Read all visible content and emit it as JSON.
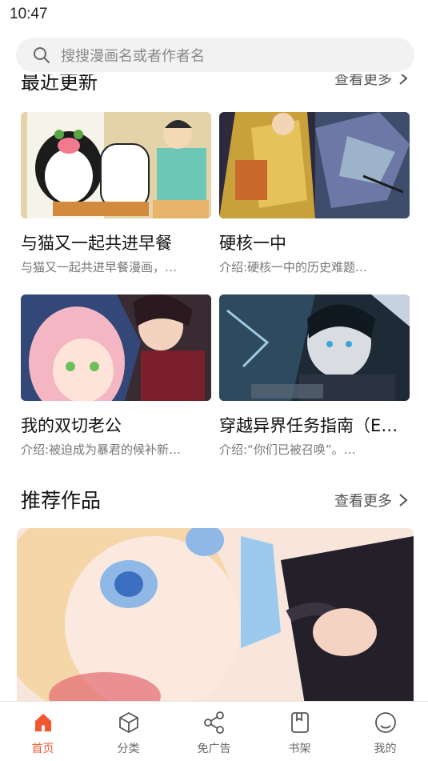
{
  "status": {
    "time": "10:47"
  },
  "search": {
    "placeholder": "搜搜漫画名或者作者名"
  },
  "recent": {
    "title": "最近更新",
    "more": "查看更多",
    "items": [
      {
        "title": "与猫又一起共进早餐",
        "desc": "与猫又一起共进早餐漫画，…"
      },
      {
        "title": "硬核一中",
        "desc": "介绍:硬核一中的历史难题…"
      },
      {
        "title": "我的双切老公",
        "desc": "介绍:被迫成为暴君的候补新…"
      },
      {
        "title": "穿越异界任务指南（E…",
        "desc": "介绍:“你们已被召唤”。…"
      }
    ]
  },
  "recommend": {
    "title": "推荐作品",
    "more": "查看更多"
  },
  "tabbar": {
    "items": [
      {
        "label": "首页",
        "icon": "home-icon",
        "active": true
      },
      {
        "label": "分类",
        "icon": "cube-icon",
        "active": false
      },
      {
        "label": "免广告",
        "icon": "share-icon",
        "active": false
      },
      {
        "label": "书架",
        "icon": "book-icon",
        "active": false
      },
      {
        "label": "我的",
        "icon": "smile-icon",
        "active": false
      }
    ],
    "active_color": "#f3572f",
    "inactive_color": "#666666"
  }
}
